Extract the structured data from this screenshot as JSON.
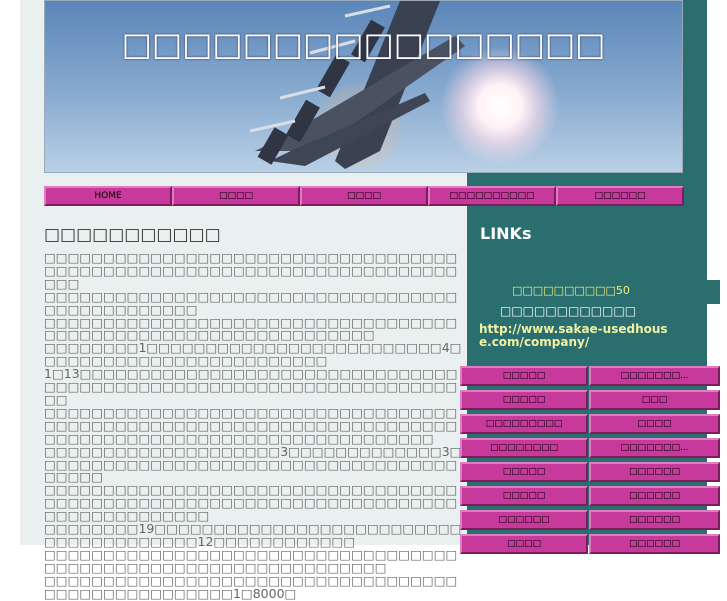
{
  "header": {
    "title": "□□□□□□□□□□□□□□□□"
  },
  "nav": {
    "items": [
      "HOME",
      "□□□□",
      "□□□□",
      "□□□□□□□□□□",
      "□□□□□□"
    ]
  },
  "main": {
    "heading": "□□□□□□□□□□□",
    "paragraphs": [
      "□□□□□□□□□□□□□□□□□□□□□□□□□□□□□□□□□□□□□□□□□□□□□□□□□□□□□□□□□□□□□□□□□□□□□□□□□",
      "□□□□□□□□□□□□□□□□□□□□□□□□□□□□□□□□□□□□□□□□□□□□□□□□",
      "□□□□□□□□□□□□□□□□□□□□□□□□□□□□□□□□□□□□□□□□□□□□□□□□□□□□□□□□□□□□□□□",
      "□□□□□□□□1□□□□□□□□□□□□□□□□□□□□□□□□□4□□□□□□□□□□□□□□□□□□□□□□□□□",
      "1□13□□□□□□□□□□□□□□□□□□□□□□□□□□□□□□□□□□□□□□□□□□□□□□□□□□□□□□□□□□□□□□□□□□□□□",
      "□□□□□□□□□□□□□□□□□□□□□□□□□□□□□□□□□□□□□□□□□□□□□□□□□□□□□□□□□□□□□□□□□□□□□□□□□□□□□□□□□□□□□□□□□□□□□□□□□□□□□□□",
      "□□□□□□□□□□□□□□□□□□□□3□□□□□□□□□□□□□3□□□□□□□□□□□□□□□□□□□□□□□□□□□□□□□□□□□□□□□□□",
      "□□□□□□□□□□□□□□□□□□□□□□□□□□□□□□□□□□□□□□□□□□□□□□□□□□□□□□□□□□□□□□□□□□□□□□□□□□□□□□□□□□□□",
      "□□□□□□□□19□□□□□□□□□□□□□□□□□□□□□□□□□□□□□□□□□□□□□□□12□□□□□□□□□□□□",
      "□□□□□□□□□□□□□□□□□□□□□□□□□□□□□□□□□□□□□□□□□□□□□□□□□□□□□□□□□□□□□□□□",
      "□□□□□□□□□□□□□□□□□□□□□□□□□□□□□□□□□□□□□□□□□□□□□□□□□□□1□8000□"
    ]
  },
  "sidebar": {
    "links_title": "LINKs",
    "link1": "□□□□□□□□□□50",
    "link2": "□□□□□□□□□□□□",
    "link3": "http://www.sakae-usedhouse.com/company/",
    "buttons": [
      "□□□□□",
      "□□□□□□□...",
      "□□□□□",
      "□□□",
      "□□□□□□□□□",
      "□□□□",
      "□□□□□□□□",
      "□□□□□□□...",
      "□□□□□",
      "□□□□□□",
      "□□□□□",
      "□□□□□□",
      "□□□□□□",
      "□□□□□□",
      "□□□□",
      "□□□□□□"
    ]
  }
}
